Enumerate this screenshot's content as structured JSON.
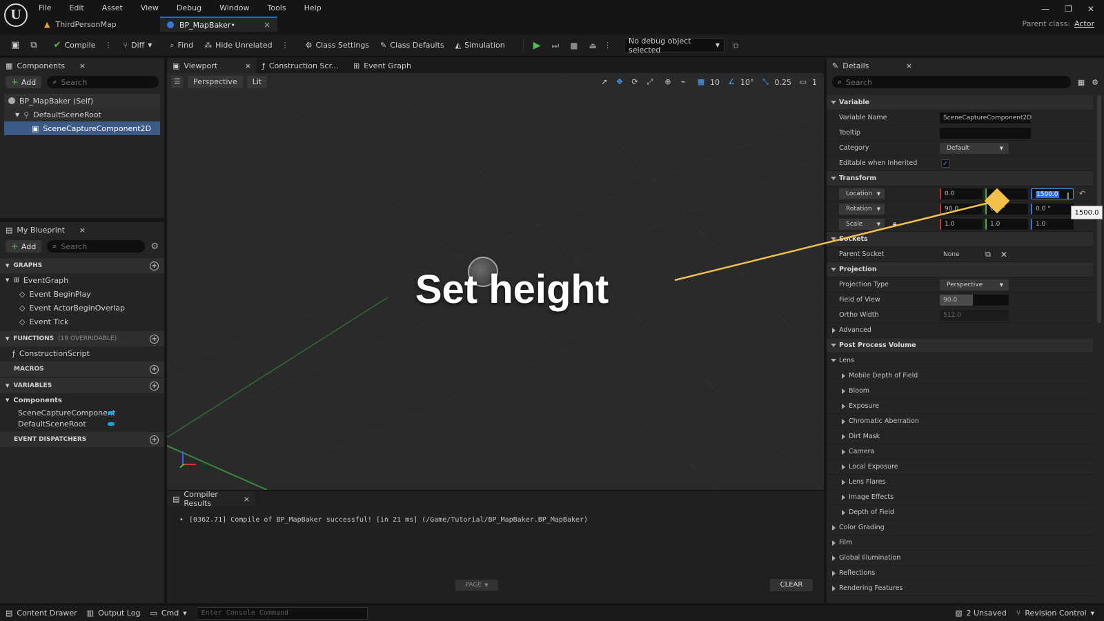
{
  "menu": [
    "File",
    "Edit",
    "Asset",
    "View",
    "Debug",
    "Window",
    "Tools",
    "Help"
  ],
  "doc_tabs": [
    {
      "label": "ThirdPersonMap"
    },
    {
      "label": "BP_MapBaker•",
      "close": "×"
    }
  ],
  "parent_class": {
    "label": "Parent class:",
    "value": "Actor"
  },
  "toolbar": {
    "compile": "Compile",
    "diff": "Diff",
    "find": "Find",
    "hide_unrelated": "Hide Unrelated",
    "class_settings": "Class Settings",
    "class_defaults": "Class Defaults",
    "simulation": "Simulation",
    "debug_object": "No debug object selected"
  },
  "components_panel": {
    "tab": "Components",
    "add": "Add",
    "search_placeholder": "Search",
    "items": [
      "BP_MapBaker (Self)",
      "DefaultSceneRoot",
      "SceneCaptureComponent2D"
    ]
  },
  "my_blueprint": {
    "tab": "My Blueprint",
    "add": "Add",
    "search_placeholder": "Search",
    "graphs": "GRAPHS",
    "event_graph": "EventGraph",
    "events": [
      "Event BeginPlay",
      "Event ActorBeginOverlap",
      "Event Tick"
    ],
    "functions": "FUNCTIONS",
    "functions_count": "(19 OVERRIDABLE)",
    "construction_script": "ConstructionScript",
    "macros": "MACROS",
    "variables": "VARIABLES",
    "components_cat": "Components",
    "var_items": [
      "SceneCaptureComponent",
      "DefaultSceneRoot"
    ],
    "event_dispatchers": "EVENT DISPATCHERS"
  },
  "editor_tabs": [
    "Viewport",
    "Construction Scr...",
    "Event Graph"
  ],
  "viewport": {
    "perspective": "Perspective",
    "lit": "Lit",
    "grid_snap": "10",
    "rot_snap": "10°",
    "scale_snap": "0.25",
    "cam_speed": "1",
    "overlay_text": "Set height"
  },
  "compiler": {
    "tab": "Compiler Results",
    "message": "[0362.71] Compile of BP_MapBaker successful! [in 21 ms] (/Game/Tutorial/BP_MapBaker.BP_MapBaker)",
    "page": "PAGE",
    "clear": "CLEAR"
  },
  "details": {
    "tab": "Details",
    "search_placeholder": "Search",
    "variable_cat": "Variable",
    "variable_name_label": "Variable Name",
    "variable_name": "SceneCaptureComponent2D",
    "tooltip_label": "Tooltip",
    "category_label": "Category",
    "category_value": "Default",
    "editable_label": "Editable when Inherited",
    "transform_cat": "Transform",
    "location_label": "Location",
    "location": [
      "0.0",
      "",
      "1500.0"
    ],
    "rotation_label": "Rotation",
    "rotation": [
      "90.0",
      "0.0 °",
      "0.0 °"
    ],
    "scale_label": "Scale",
    "scale": [
      "1.0",
      "1.0",
      "1.0"
    ],
    "tooltip_popup": "1500.0",
    "sockets_cat": "Sockets",
    "parent_socket_label": "Parent Socket",
    "parent_socket": "None",
    "projection_cat": "Projection",
    "projection_type_label": "Projection Type",
    "projection_type": "Perspective",
    "fov_label": "Field of View",
    "fov": "90.0",
    "ortho_label": "Ortho Width",
    "ortho": "512.0",
    "advanced": "Advanced",
    "ppv_cat": "Post Process Volume",
    "lens": "Lens",
    "lens_items": [
      "Mobile Depth of Field",
      "Bloom",
      "Exposure",
      "Chromatic Aberration",
      "Dirt Mask",
      "Camera",
      "Local Exposure",
      "Lens Flares",
      "Image Effects",
      "Depth of Field"
    ],
    "more_items": [
      "Color Grading",
      "Film",
      "Global Illumination",
      "Reflections",
      "Rendering Features"
    ]
  },
  "statusbar": {
    "content_drawer": "Content Drawer",
    "output_log": "Output Log",
    "cmd": "Cmd",
    "console_placeholder": "Enter Console Command",
    "unsaved": "2 Unsaved",
    "revision": "Revision Control"
  },
  "colors": {
    "accent_blue": "#1a6fd6",
    "selection": "#3c5a86",
    "overlay_yellow": "#f3c14a"
  }
}
